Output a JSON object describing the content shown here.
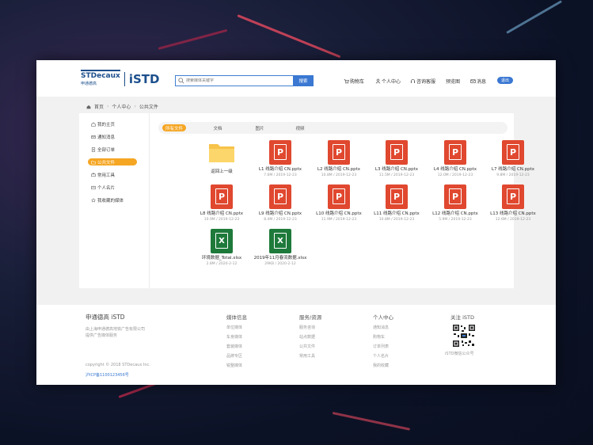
{
  "header": {
    "logo_st": "STDecaux",
    "logo_st_sub": "申通德高",
    "logo_istd": "iSTD",
    "search_placeholder": "搜索媒体关键字",
    "search_button": "搜索",
    "nav": [
      "购物车",
      "个人中心",
      "咨询客服",
      "预览图",
      "消息"
    ],
    "exit": "退出"
  },
  "breadcrumb": [
    "首页",
    "个人中心",
    "公共文件"
  ],
  "sidebar": {
    "items": [
      {
        "label": "我的主页",
        "icon": "home-icon"
      },
      {
        "label": "通知消息",
        "icon": "mail-icon"
      },
      {
        "label": "全部订单",
        "icon": "order-icon"
      },
      {
        "label": "公共文件",
        "icon": "folder-icon",
        "active": true
      },
      {
        "label": "常用工具",
        "icon": "tool-icon"
      },
      {
        "label": "个人名片",
        "icon": "card-icon"
      },
      {
        "label": "我收藏的媒体",
        "icon": "star-icon"
      }
    ]
  },
  "tabs": [
    "所有文件",
    "文档",
    "图片",
    "视频"
  ],
  "files": [
    {
      "type": "folder",
      "name": "返回上一级",
      "meta": ""
    },
    {
      "type": "ppt",
      "name": "L1 线路介绍 CN.pptx",
      "meta": "7.6M / 2019-12-23"
    },
    {
      "type": "ppt",
      "name": "L2 线路介绍 CN.pptx",
      "meta": "10.8M / 2019-12-23"
    },
    {
      "type": "ppt",
      "name": "L3 线路介绍 CN.pptx",
      "meta": "11.5M / 2019-12-23"
    },
    {
      "type": "ppt",
      "name": "L4 线路介绍 CN.pptx",
      "meta": "12.0M / 2019-12-23"
    },
    {
      "type": "ppt",
      "name": "L7 线路介绍 CN.pptx",
      "meta": "9.8M / 2019-12-23"
    },
    {
      "type": "ppt",
      "name": "L8 线路介绍 CN.pptx",
      "meta": "10.9M / 2019-12-23"
    },
    {
      "type": "ppt",
      "name": "L9 线路介绍 CN.pptx",
      "meta": "8.4M / 2019-12-23"
    },
    {
      "type": "ppt",
      "name": "L10 线路介绍 CN.pptx",
      "meta": "11.9M / 2019-12-23"
    },
    {
      "type": "ppt",
      "name": "L11 线路介绍 CN.pptx",
      "meta": "10.8M / 2019-12-23"
    },
    {
      "type": "ppt",
      "name": "L12 线路介绍 CN.pptx",
      "meta": "5.9M / 2019-12-23"
    },
    {
      "type": "ppt",
      "name": "L13 线路介绍 CN.pptx",
      "meta": "12.6M / 2019-12-23"
    },
    {
      "type": "xls",
      "name": "环境数据_Total.xlsx",
      "meta": "2.8M / 2020-2-12"
    },
    {
      "type": "xls",
      "name": "2019年11月春流数据.xlsx",
      "meta": "29KB / 2020-2-12"
    }
  ],
  "footer": {
    "brand_title": "申通德高 iSTD",
    "brand_desc": [
      "由上海申通德高地铁广告有限公司",
      "提供广告媒体服务"
    ],
    "copyright": "copyright © 2018 STDecaux Inc.",
    "icp": "沪ICP备1100123456号",
    "cols": [
      {
        "title": "媒体信息",
        "links": [
          "单位媒体",
          "车身媒体",
          "套装媒体",
          "品牌专区",
          "锐整媒体"
        ]
      },
      {
        "title": "服务/资源",
        "links": [
          "服务咨询",
          "站点数据",
          "公共文件",
          "常用工具"
        ]
      },
      {
        "title": "个人中心",
        "links": [
          "通知消息",
          "购物车",
          "订单列表",
          "个人名片",
          "我的收藏"
        ]
      }
    ],
    "follow_title": "关注 iSTD",
    "qr_label": "iSTD微信公众号"
  }
}
